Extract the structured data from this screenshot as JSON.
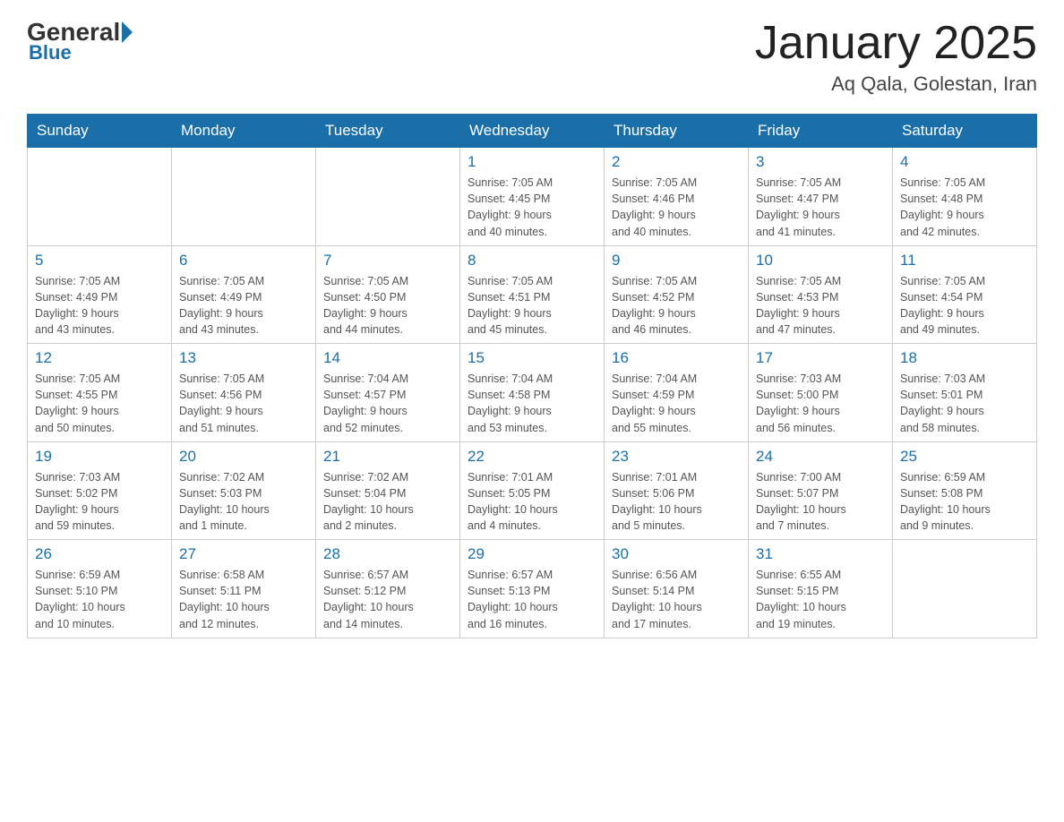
{
  "header": {
    "logo": {
      "general": "General",
      "blue": "Blue"
    },
    "title": "January 2025",
    "location": "Aq Qala, Golestan, Iran"
  },
  "days_of_week": [
    "Sunday",
    "Monday",
    "Tuesday",
    "Wednesday",
    "Thursday",
    "Friday",
    "Saturday"
  ],
  "weeks": [
    [
      {
        "day": "",
        "info": ""
      },
      {
        "day": "",
        "info": ""
      },
      {
        "day": "",
        "info": ""
      },
      {
        "day": "1",
        "info": "Sunrise: 7:05 AM\nSunset: 4:45 PM\nDaylight: 9 hours\nand 40 minutes."
      },
      {
        "day": "2",
        "info": "Sunrise: 7:05 AM\nSunset: 4:46 PM\nDaylight: 9 hours\nand 40 minutes."
      },
      {
        "day": "3",
        "info": "Sunrise: 7:05 AM\nSunset: 4:47 PM\nDaylight: 9 hours\nand 41 minutes."
      },
      {
        "day": "4",
        "info": "Sunrise: 7:05 AM\nSunset: 4:48 PM\nDaylight: 9 hours\nand 42 minutes."
      }
    ],
    [
      {
        "day": "5",
        "info": "Sunrise: 7:05 AM\nSunset: 4:49 PM\nDaylight: 9 hours\nand 43 minutes."
      },
      {
        "day": "6",
        "info": "Sunrise: 7:05 AM\nSunset: 4:49 PM\nDaylight: 9 hours\nand 43 minutes."
      },
      {
        "day": "7",
        "info": "Sunrise: 7:05 AM\nSunset: 4:50 PM\nDaylight: 9 hours\nand 44 minutes."
      },
      {
        "day": "8",
        "info": "Sunrise: 7:05 AM\nSunset: 4:51 PM\nDaylight: 9 hours\nand 45 minutes."
      },
      {
        "day": "9",
        "info": "Sunrise: 7:05 AM\nSunset: 4:52 PM\nDaylight: 9 hours\nand 46 minutes."
      },
      {
        "day": "10",
        "info": "Sunrise: 7:05 AM\nSunset: 4:53 PM\nDaylight: 9 hours\nand 47 minutes."
      },
      {
        "day": "11",
        "info": "Sunrise: 7:05 AM\nSunset: 4:54 PM\nDaylight: 9 hours\nand 49 minutes."
      }
    ],
    [
      {
        "day": "12",
        "info": "Sunrise: 7:05 AM\nSunset: 4:55 PM\nDaylight: 9 hours\nand 50 minutes."
      },
      {
        "day": "13",
        "info": "Sunrise: 7:05 AM\nSunset: 4:56 PM\nDaylight: 9 hours\nand 51 minutes."
      },
      {
        "day": "14",
        "info": "Sunrise: 7:04 AM\nSunset: 4:57 PM\nDaylight: 9 hours\nand 52 minutes."
      },
      {
        "day": "15",
        "info": "Sunrise: 7:04 AM\nSunset: 4:58 PM\nDaylight: 9 hours\nand 53 minutes."
      },
      {
        "day": "16",
        "info": "Sunrise: 7:04 AM\nSunset: 4:59 PM\nDaylight: 9 hours\nand 55 minutes."
      },
      {
        "day": "17",
        "info": "Sunrise: 7:03 AM\nSunset: 5:00 PM\nDaylight: 9 hours\nand 56 minutes."
      },
      {
        "day": "18",
        "info": "Sunrise: 7:03 AM\nSunset: 5:01 PM\nDaylight: 9 hours\nand 58 minutes."
      }
    ],
    [
      {
        "day": "19",
        "info": "Sunrise: 7:03 AM\nSunset: 5:02 PM\nDaylight: 9 hours\nand 59 minutes."
      },
      {
        "day": "20",
        "info": "Sunrise: 7:02 AM\nSunset: 5:03 PM\nDaylight: 10 hours\nand 1 minute."
      },
      {
        "day": "21",
        "info": "Sunrise: 7:02 AM\nSunset: 5:04 PM\nDaylight: 10 hours\nand 2 minutes."
      },
      {
        "day": "22",
        "info": "Sunrise: 7:01 AM\nSunset: 5:05 PM\nDaylight: 10 hours\nand 4 minutes."
      },
      {
        "day": "23",
        "info": "Sunrise: 7:01 AM\nSunset: 5:06 PM\nDaylight: 10 hours\nand 5 minutes."
      },
      {
        "day": "24",
        "info": "Sunrise: 7:00 AM\nSunset: 5:07 PM\nDaylight: 10 hours\nand 7 minutes."
      },
      {
        "day": "25",
        "info": "Sunrise: 6:59 AM\nSunset: 5:08 PM\nDaylight: 10 hours\nand 9 minutes."
      }
    ],
    [
      {
        "day": "26",
        "info": "Sunrise: 6:59 AM\nSunset: 5:10 PM\nDaylight: 10 hours\nand 10 minutes."
      },
      {
        "day": "27",
        "info": "Sunrise: 6:58 AM\nSunset: 5:11 PM\nDaylight: 10 hours\nand 12 minutes."
      },
      {
        "day": "28",
        "info": "Sunrise: 6:57 AM\nSunset: 5:12 PM\nDaylight: 10 hours\nand 14 minutes."
      },
      {
        "day": "29",
        "info": "Sunrise: 6:57 AM\nSunset: 5:13 PM\nDaylight: 10 hours\nand 16 minutes."
      },
      {
        "day": "30",
        "info": "Sunrise: 6:56 AM\nSunset: 5:14 PM\nDaylight: 10 hours\nand 17 minutes."
      },
      {
        "day": "31",
        "info": "Sunrise: 6:55 AM\nSunset: 5:15 PM\nDaylight: 10 hours\nand 19 minutes."
      },
      {
        "day": "",
        "info": ""
      }
    ]
  ]
}
